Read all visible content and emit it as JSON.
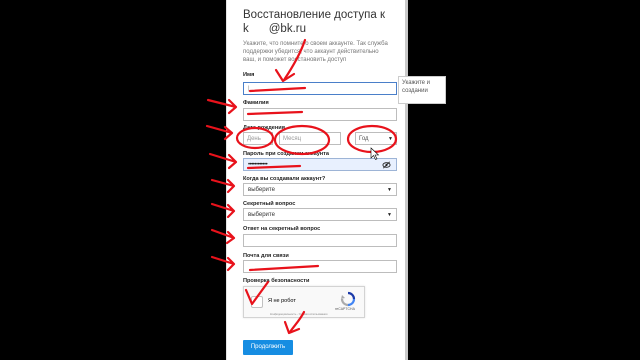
{
  "form": {
    "title_line1": "Восстановление доступа к",
    "title_line2_prefix": "k",
    "title_line2_domain": "@bk.ru",
    "description": "Укажите, что помните о своем аккаунте. Так служба поддержки убедится, что аккаунт действительно ваш, и поможет восстановить доступ",
    "fields": {
      "name_label": "Имя",
      "surname_label": "Фамилия",
      "birthdate_label": "Дата рождения",
      "day_placeholder": "День",
      "month_placeholder": "Месяц",
      "year_value": "Год",
      "password_label": "Пароль при создании аккаунта",
      "password_value": "••••••••••••",
      "created_label": "Когда вы создавали аккаунт?",
      "created_value": "выберите",
      "question_label": "Секретный вопрос",
      "question_value": "выберите",
      "answer_label": "Ответ на секретный вопрос",
      "contact_email_label": "Почта для связи",
      "security_label": "Проверка безопасности"
    },
    "captcha": {
      "checkbox_label": "Я не робот",
      "brand": "reCAPTCHA",
      "footer": "Конфиденциальность - Условия использования"
    },
    "submit_label": "Продолжить"
  },
  "tooltip": {
    "line1": "Укажите и",
    "line2": "создании"
  },
  "colors": {
    "background": "#000000",
    "page": "#ffffff",
    "primary_button": "#168de2",
    "annotation": "#e8121b",
    "autofill": "#e8f0fe"
  },
  "icons": {
    "password_toggle": "eye-slash-icon",
    "select_arrow": "caret-down-icon",
    "captcha_logo": "recaptcha-logo-icon"
  }
}
